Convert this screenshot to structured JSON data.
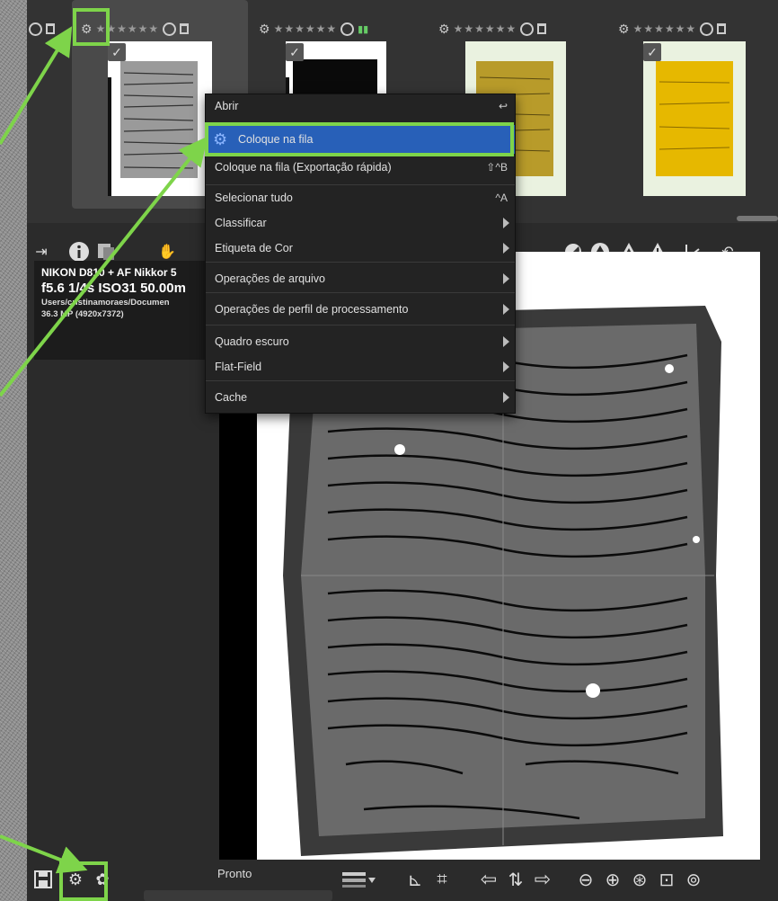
{
  "context_menu": {
    "items": [
      {
        "label": "Abrir",
        "shortcut": "↩"
      },
      {
        "label": "Coloque na fila",
        "highlighted": true
      },
      {
        "label": "Coloque na fila (Exportação rápida)",
        "shortcut": "⇧^B"
      },
      {
        "label": "Selecionar tudo",
        "shortcut": "^A"
      },
      {
        "label": "Classificar"
      },
      {
        "label": "Etiqueta de Cor"
      },
      {
        "label": "Operações de arquivo"
      },
      {
        "label": "Operações de perfil de processamento"
      },
      {
        "label": "Quadro escuro"
      },
      {
        "label": "Flat-Field"
      },
      {
        "label": "Cache"
      }
    ]
  },
  "thumbnail": {
    "stars": "★★★★★★"
  },
  "image_info": {
    "camera": "NIKON D810 + AF Nikkor 5",
    "exposure": "f5.6  1/4s  ISO31  50.00m",
    "path": "Users/cristinamoraes/Documen",
    "size": "36.3 MP (4920x7372)"
  },
  "status": {
    "text": "Pronto"
  },
  "colors": {
    "highlight": "#2860b8",
    "annotation": "#7ed44a",
    "panel": "#2b2b2b"
  }
}
